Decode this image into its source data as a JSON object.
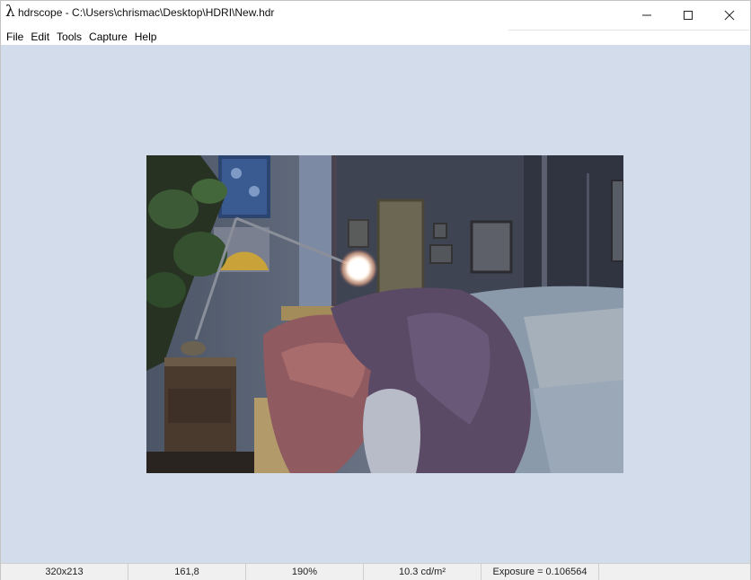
{
  "window": {
    "app_icon": "λ",
    "title": "hdrscope - C:\\Users\\chrismac\\Desktop\\HDRI\\New.hdr",
    "controls": [
      "minimize-icon",
      "maximize-icon",
      "close-icon"
    ]
  },
  "menu": {
    "items": [
      "File",
      "Edit",
      "Tools",
      "Capture",
      "Help"
    ]
  },
  "image": {
    "icon": "hdr-photo"
  },
  "status": {
    "resolution": "320x213",
    "coordinates": "161,8",
    "zoom": "190%",
    "luminance": "10.3 cd/m²",
    "exposure": "Exposure = 0.106564"
  },
  "colors": {
    "background": "#d3dceb",
    "statusbar": "#f0f0f0"
  }
}
